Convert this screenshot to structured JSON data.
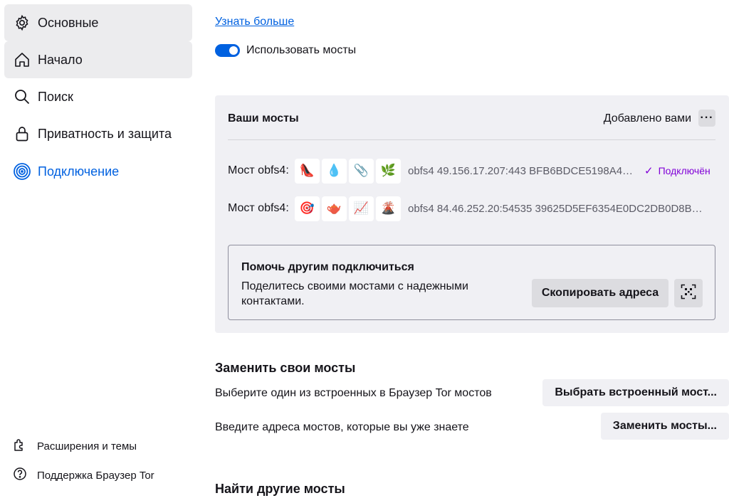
{
  "sidebar": {
    "items": [
      {
        "label": "Основные",
        "icon": "gear-icon"
      },
      {
        "label": "Начало",
        "icon": "home-icon"
      },
      {
        "label": "Поиск",
        "icon": "search-icon"
      },
      {
        "label": "Приватность и защита",
        "icon": "lock-icon"
      },
      {
        "label": "Подключение",
        "icon": "connection-icon"
      }
    ],
    "footer": [
      {
        "label": "Расширения и темы",
        "icon": "puzzle-icon"
      },
      {
        "label": "Поддержка Браузер Tor",
        "icon": "help-icon"
      }
    ]
  },
  "main": {
    "learn_more": "Узнать больше",
    "use_bridges_label": "Использовать мосты",
    "use_bridges_enabled": true,
    "your_bridges": {
      "title": "Ваши мосты",
      "source": "Добавлено вами",
      "more_label": "···",
      "bridges": [
        {
          "label": "Мост obfs4:",
          "emojis": [
            "👠",
            "💧",
            "📎",
            "🌿"
          ],
          "line": "obfs4 49.156.17.207:443 BFB6BDCE5198A4…",
          "status": "Подключён"
        },
        {
          "label": "Мост obfs4:",
          "emojis": [
            "🎯",
            "🫖",
            "📈",
            "🌋"
          ],
          "line": "obfs4 84.46.252.20:54535 39625D5EF6354E0DC2DB0D8B…"
        }
      ]
    },
    "help": {
      "title": "Помочь другим подключиться",
      "text": "Поделитесь своими мостами с надежными контактами.",
      "copy_label": "Скопировать адреса"
    },
    "replace": {
      "title": "Заменить свои мосты",
      "builtin_text": "Выберите один из встроенных в Браузер Tor мостов",
      "builtin_button": "Выбрать встроенный мост...",
      "manual_text": "Введите адреса мостов, которые вы уже знаете",
      "manual_button": "Заменить мосты..."
    },
    "find_title": "Найти другие мосты"
  }
}
